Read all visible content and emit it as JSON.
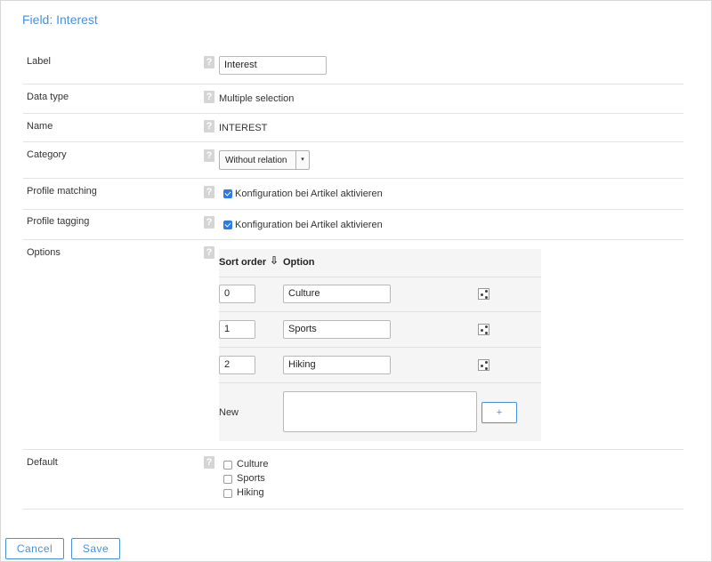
{
  "page": {
    "title": "Field: Interest"
  },
  "help_glyph": "?",
  "fields": {
    "label": {
      "label": "Label",
      "value": "Interest"
    },
    "data_type": {
      "label": "Data type",
      "value": "Multiple selection"
    },
    "name": {
      "label": "Name",
      "value": "INTEREST"
    },
    "category": {
      "label": "Category",
      "selected": "Without relation",
      "arrow": "▾"
    },
    "profile_matching": {
      "label": "Profile matching",
      "checkbox_label": "Konfiguration bei Artikel aktivieren",
      "checked": true
    },
    "profile_tagging": {
      "label": "Profile tagging",
      "checkbox_label": "Konfiguration bei Artikel aktivieren",
      "checked": true
    },
    "options": {
      "label": "Options",
      "col_sort_order": "Sort order",
      "sort_icon": "⇩",
      "col_option": "Option",
      "rows": [
        {
          "order": "0",
          "option": "Culture",
          "icon": "share-icon"
        },
        {
          "order": "1",
          "option": "Sports",
          "icon": "share-icon"
        },
        {
          "order": "2",
          "option": "Hiking",
          "icon": "share-icon"
        }
      ],
      "new_label": "New",
      "new_value": "",
      "add_label": "+"
    },
    "default": {
      "label": "Default",
      "items": [
        {
          "label": "Culture",
          "checked": false
        },
        {
          "label": "Sports",
          "checked": false
        },
        {
          "label": "Hiking",
          "checked": false
        }
      ]
    }
  },
  "actions": {
    "cancel": "Cancel",
    "save": "Save"
  },
  "colors": {
    "accent": "#4a90d9",
    "checkbox": "#2d7be5",
    "help_bg": "#d5d5d5",
    "table_bg": "#f5f5f5"
  }
}
